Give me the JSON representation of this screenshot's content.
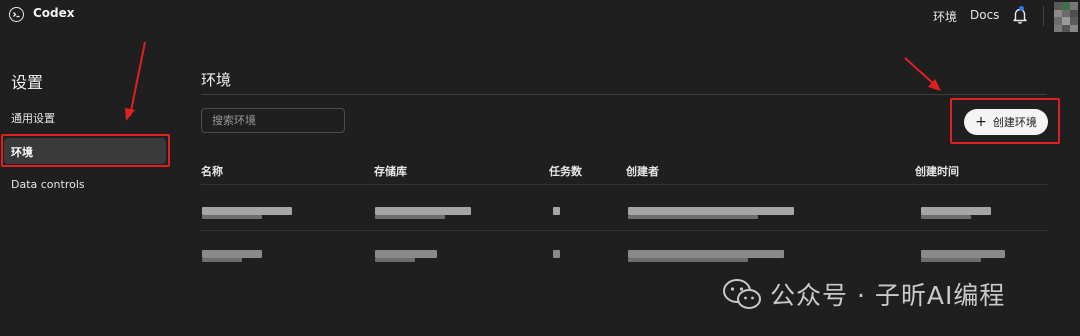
{
  "app": {
    "title": "Codex"
  },
  "topbar": {
    "env_link": "环境",
    "docs_link": "Docs",
    "icons": [
      "codex-logo-icon",
      "bell-icon"
    ]
  },
  "sidebar": {
    "title": "设置",
    "items": [
      {
        "label": "通用设置",
        "active": false
      },
      {
        "label": "环境",
        "active": true
      },
      {
        "label": "Data controls",
        "active": false
      }
    ]
  },
  "main": {
    "title": "环境",
    "search_placeholder": "搜索环境",
    "create_button": "创建环境",
    "table": {
      "columns": [
        "名称",
        "存储库",
        "任务数",
        "创建者",
        "创建时间"
      ],
      "rows": [
        {
          "name": "",
          "repo": "",
          "tasks": "",
          "creator": "",
          "created": ""
        },
        {
          "name": "",
          "repo": "",
          "tasks": "",
          "creator": "",
          "created": ""
        }
      ]
    }
  },
  "annotations": {
    "highlight_color": "#e02020"
  },
  "watermark": {
    "text": "公众号 · 子昕AI编程"
  },
  "colors": {
    "background": "#1f1f1f",
    "active_item": "#3a3a3a",
    "accent_blue": "#2f7bf6",
    "button_bg": "#f4f4f4"
  }
}
